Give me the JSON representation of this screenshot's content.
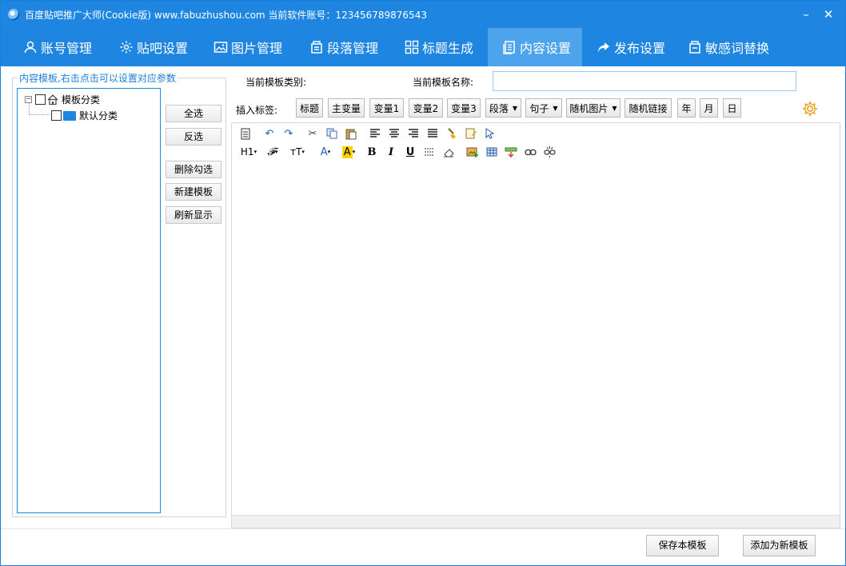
{
  "window": {
    "title": "百度贴吧推广大师(Cookie版)  www.fabuzhushou.com   当前软件账号：123456789876543",
    "minimize_label": "–",
    "close_label": "✕"
  },
  "nav": {
    "tabs": [
      {
        "label": "账号管理",
        "icon": "user-icon"
      },
      {
        "label": "贴吧设置",
        "icon": "gear-icon"
      },
      {
        "label": "图片管理",
        "icon": "image-icon"
      },
      {
        "label": "段落管理",
        "icon": "paragraph-icon"
      },
      {
        "label": "标题生成",
        "icon": "grid-icon"
      },
      {
        "label": "内容设置",
        "icon": "document-icon",
        "active": true
      },
      {
        "label": "发布设置",
        "icon": "share-arrow-icon"
      },
      {
        "label": "敏感词替换",
        "icon": "replace-icon"
      }
    ]
  },
  "left_panel": {
    "legend": "内容模板,右击点击可以设置对应参数",
    "tree": {
      "root_label": "模板分类",
      "root_expander": "−",
      "child_label": "默认分类"
    },
    "buttons": {
      "select_all": "全选",
      "invert": "反选",
      "delete_checked": "删除勾选",
      "new_template": "新建模板",
      "refresh": "刷新显示"
    }
  },
  "template_info": {
    "category_label": "当前模板类别:",
    "name_label": "当前模板名称:",
    "name_value": ""
  },
  "insert_tags": {
    "label": "插入标签:",
    "tags": [
      {
        "label": "标题"
      },
      {
        "label": "主变量"
      },
      {
        "label": "变量1"
      },
      {
        "label": "变量2"
      },
      {
        "label": "变量3"
      },
      {
        "label": "段落",
        "dropdown": true
      },
      {
        "label": "句子",
        "dropdown": true
      },
      {
        "label": "随机图片",
        "dropdown": true
      },
      {
        "label": "随机链接"
      },
      {
        "label": "年"
      },
      {
        "label": "月"
      },
      {
        "label": "日"
      }
    ]
  },
  "editor": {
    "toolbar_row1": [
      "source-icon",
      "undo-icon",
      "redo-icon",
      "cut-icon",
      "copy-icon",
      "paste-icon",
      "align-left-icon",
      "align-center-icon",
      "align-right-icon",
      "justify-icon",
      "format-brush-icon",
      "clear-format-icon",
      "select-icon"
    ],
    "toolbar_row2_text": {
      "heading": "H1",
      "font_family": "𝓕",
      "font_size": "тT",
      "font_color": "A",
      "bg_color": "A",
      "bold": "B",
      "italic": "I",
      "underline": "U"
    },
    "toolbar_row2_icons": [
      "strikethrough-icon",
      "eraser-icon",
      "insert-image-icon",
      "table-icon",
      "insert-row-icon",
      "link-icon",
      "unlink-icon"
    ],
    "content": ""
  },
  "footer": {
    "save_label": "保存本模板",
    "add_new_label": "添加为新模板"
  },
  "colors": {
    "brand": "#1e86e0",
    "active_tab": "#4ea4ec",
    "accent_orange": "#f0a020"
  }
}
